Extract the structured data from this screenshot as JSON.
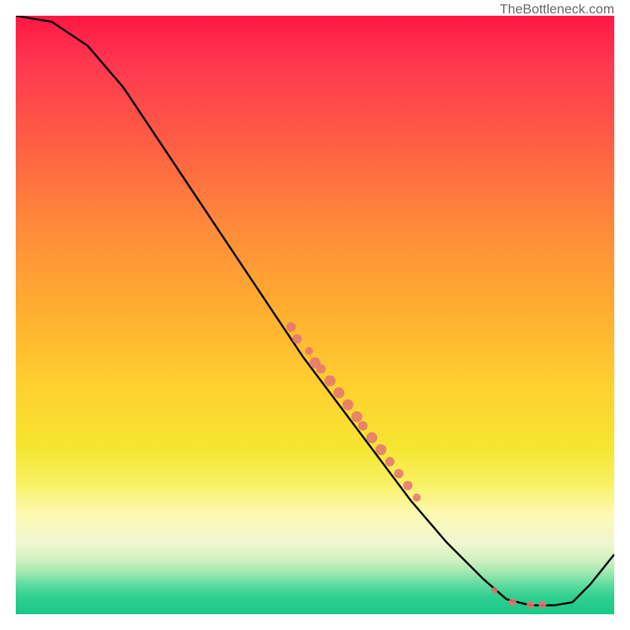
{
  "attribution": "TheBottleneck.com",
  "chart_data": {
    "type": "line",
    "title": "",
    "xlabel": "",
    "ylabel": "",
    "xlim": [
      0,
      100
    ],
    "ylim": [
      0,
      100
    ],
    "curve": [
      {
        "x": 0,
        "y": 100
      },
      {
        "x": 6,
        "y": 99
      },
      {
        "x": 12,
        "y": 95
      },
      {
        "x": 18,
        "y": 88
      },
      {
        "x": 24,
        "y": 79
      },
      {
        "x": 30,
        "y": 70
      },
      {
        "x": 36,
        "y": 61
      },
      {
        "x": 42,
        "y": 52
      },
      {
        "x": 48,
        "y": 43
      },
      {
        "x": 54,
        "y": 35
      },
      {
        "x": 60,
        "y": 27
      },
      {
        "x": 66,
        "y": 19
      },
      {
        "x": 72,
        "y": 12
      },
      {
        "x": 78,
        "y": 6
      },
      {
        "x": 82,
        "y": 2.5
      },
      {
        "x": 86,
        "y": 1.5
      },
      {
        "x": 90,
        "y": 1.5
      },
      {
        "x": 93,
        "y": 2
      },
      {
        "x": 96,
        "y": 5
      },
      {
        "x": 100,
        "y": 10
      }
    ],
    "scatter_points": [
      {
        "x": 46,
        "y": 48,
        "r": 6
      },
      {
        "x": 47,
        "y": 46,
        "r": 6
      },
      {
        "x": 49,
        "y": 44,
        "r": 5
      },
      {
        "x": 50,
        "y": 42,
        "r": 7
      },
      {
        "x": 51,
        "y": 41,
        "r": 6
      },
      {
        "x": 52.5,
        "y": 39,
        "r": 7
      },
      {
        "x": 54,
        "y": 37,
        "r": 7
      },
      {
        "x": 55.5,
        "y": 35,
        "r": 7
      },
      {
        "x": 57,
        "y": 33,
        "r": 7
      },
      {
        "x": 58,
        "y": 31.5,
        "r": 6
      },
      {
        "x": 59.5,
        "y": 29.5,
        "r": 7
      },
      {
        "x": 61,
        "y": 27.5,
        "r": 7
      },
      {
        "x": 62.5,
        "y": 25.5,
        "r": 6
      },
      {
        "x": 64,
        "y": 23.5,
        "r": 6
      },
      {
        "x": 65.5,
        "y": 21.5,
        "r": 6
      },
      {
        "x": 67,
        "y": 19.5,
        "r": 5
      },
      {
        "x": 80,
        "y": 4,
        "r": 4
      },
      {
        "x": 83,
        "y": 2,
        "r": 5
      },
      {
        "x": 86,
        "y": 1.6,
        "r": 5
      },
      {
        "x": 88,
        "y": 1.6,
        "r": 5
      }
    ],
    "colors": {
      "point_fill": "#e57373",
      "line": "#000000"
    }
  }
}
